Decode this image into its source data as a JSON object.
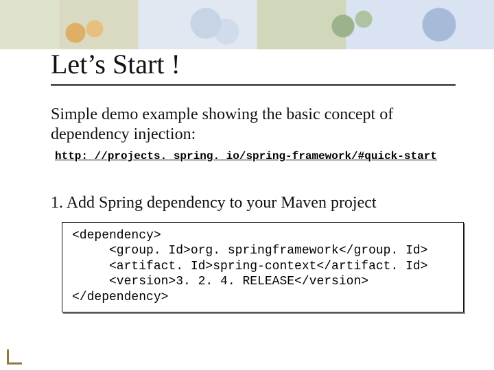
{
  "title": "Let’s Start !",
  "lead": "Simple demo example showing the basic concept of dependency injection:",
  "link_text": "http: //projects. spring. io/spring-framework/#quick-start",
  "step_prefix": "1.   ",
  "step_text": "Add Spring dependency to your Maven project",
  "code": "<dependency>\n     <group. Id>org. springframework</group. Id>\n     <artifact. Id>spring-context</artifact. Id>\n     <version>3. 2. 4. RELEASE</version>\n</dependency>"
}
